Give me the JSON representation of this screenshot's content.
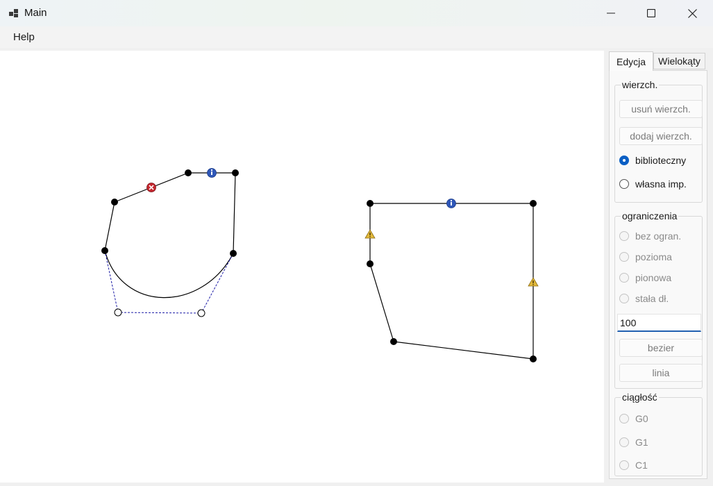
{
  "window": {
    "title": "Main"
  },
  "menu": {
    "help": "Help"
  },
  "tabs": [
    {
      "label": "Edycja",
      "active": true
    },
    {
      "label": "Wielokąty",
      "active": false
    }
  ],
  "vertex_group": {
    "label": "wierzch.",
    "remove_button": "usuń wierzch.",
    "add_button": "dodaj wierzch.",
    "radios": [
      {
        "label": "biblioteczny",
        "checked": true
      },
      {
        "label": "własna imp.",
        "checked": false
      }
    ]
  },
  "constraints_group": {
    "label": "ograniczenia",
    "radios": [
      {
        "label": "bez ogran.",
        "enabled": false
      },
      {
        "label": "pozioma",
        "enabled": false
      },
      {
        "label": "pionowa",
        "enabled": false
      },
      {
        "label": "stała dł.",
        "enabled": false
      }
    ],
    "length_value": "100",
    "bezier_button": "bezier",
    "line_button": "linia"
  },
  "continuity_group": {
    "label": "ciągłość",
    "radios": [
      {
        "label": "G0",
        "enabled": false
      },
      {
        "label": "G1",
        "enabled": false
      },
      {
        "label": "C1",
        "enabled": false
      }
    ]
  },
  "colors": {
    "edge": "#000000",
    "bezier_control": "#1a1aa6",
    "info_marker": "#2f57b8",
    "error_marker": "#c4262e",
    "warning_marker": "#e2b93b",
    "accent": "#0a5fc4"
  },
  "marker_icons": [
    "info-icon",
    "error-icon",
    "warning-icon"
  ]
}
